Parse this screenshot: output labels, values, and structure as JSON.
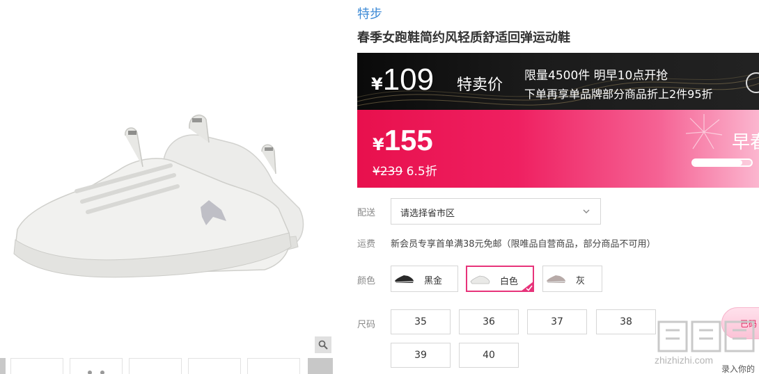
{
  "brand": "特步",
  "title": "春季女跑鞋简约风轻质舒适回弹运动鞋",
  "flash_sale": {
    "currency": "¥",
    "price": "109",
    "tag": "特卖价",
    "line1": "限量4500件 明早10点开抢",
    "line2": "下单再享单品牌部分商品折上2件95折"
  },
  "vip_sale": {
    "currency": "¥",
    "price": "155",
    "original_price": "¥239",
    "discount": "6.5折",
    "promo": "早春",
    "progress": 0.85
  },
  "delivery": {
    "label": "配送",
    "placeholder": "请选择省市区"
  },
  "shipping": {
    "label": "运费",
    "text": "新会员专享首单满38元免邮（限唯品自营商品，部分商品不可用）"
  },
  "colors": {
    "label": "颜色",
    "options": [
      {
        "name": "黑金",
        "selected": false
      },
      {
        "name": "白色",
        "selected": true
      },
      {
        "name": "灰",
        "selected": false
      }
    ]
  },
  "sizes": {
    "label": "尺码",
    "options": [
      "35",
      "36",
      "37",
      "38",
      "39",
      "40"
    ]
  },
  "side_widget": {
    "text": "已码"
  },
  "watermark": {
    "logo": "值",
    "url": "zhizhizhi.com",
    "sub": "录入你的"
  },
  "theme": {
    "brand_blue": "#3d8ad6",
    "vip_pink": "#e8104d",
    "selected_border": "#e7337a"
  }
}
